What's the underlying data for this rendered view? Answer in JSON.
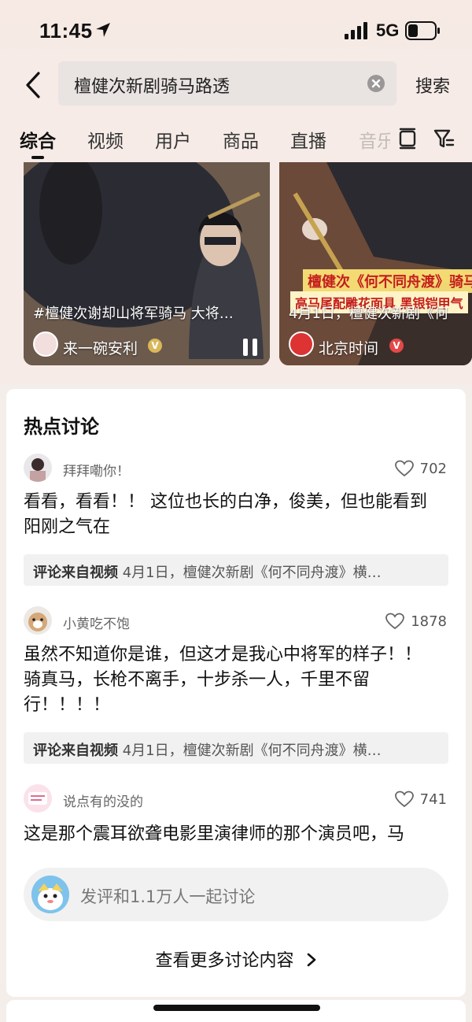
{
  "status_bar": {
    "time": "11:45",
    "network": "5G"
  },
  "search": {
    "query": "檀健次新剧骑马路透",
    "action_label": "搜索"
  },
  "tabs": [
    {
      "label": "综合",
      "active": true
    },
    {
      "label": "视频"
    },
    {
      "label": "用户"
    },
    {
      "label": "商品"
    },
    {
      "label": "直播"
    },
    {
      "label": "音乐"
    }
  ],
  "videos": [
    {
      "caption": "#檀健次谢却山将军骑马 大将…",
      "author": "来一碗安利"
    },
    {
      "caption": "4月1日，檀健次新剧《何",
      "author": "北京时间",
      "overlay_title": "檀健次《何不同舟渡》骑马",
      "overlay_sub": "高马尾配雕花面具 黑银铠甲气"
    }
  ],
  "discussion": {
    "title": "热点讨论",
    "comments": [
      {
        "user": "拜拜嘞你！",
        "likes": "702",
        "text": "看看，看看！！ 这位也长的白净，俊美，但也能看到阳刚之气在",
        "source_label": "评论来自视频",
        "source_text": "4月1日，檀健次新剧《何不同舟渡》横…"
      },
      {
        "user": "小黄吃不饱",
        "likes": "1878",
        "text": "虽然不知道你是谁，但这才是我心中将军的样子！！ 骑真马，长枪不离手，十步杀一人，千里不留行！！！！",
        "source_label": "评论来自视频",
        "source_text": "4月1日，檀健次新剧《何不同舟渡》横…"
      },
      {
        "user": "说点有的没的",
        "likes": "741",
        "text": "这是那个震耳欲聋电影里演律师的那个演员吧，马"
      }
    ],
    "input_placeholder": "发评和1.1万人一起讨论",
    "more_label": "查看更多讨论内容"
  }
}
